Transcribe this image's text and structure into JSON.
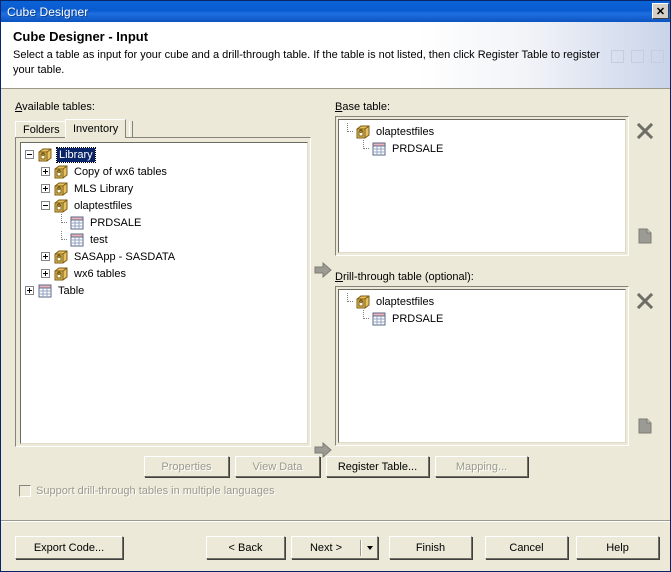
{
  "window": {
    "title": "Cube Designer",
    "close_label": "✕"
  },
  "header": {
    "title": "Cube Designer - Input",
    "description": "Select a table as input for your cube and a drill-through table. If the table is not listed, then click Register Table to register your table."
  },
  "left_panel": {
    "label": "Available tables:",
    "tabs": [
      {
        "label": "Folders",
        "active": false
      },
      {
        "label": "Inventory",
        "active": true
      }
    ],
    "tree": [
      {
        "label": "Library",
        "indent": 0,
        "expander": "minus",
        "icon": "library-icon",
        "selected": true
      },
      {
        "label": "Copy of wx6 tables",
        "indent": 1,
        "expander": "plus",
        "icon": "library-icon",
        "selected": false
      },
      {
        "label": "MLS Library",
        "indent": 1,
        "expander": "plus",
        "icon": "library-icon",
        "selected": false
      },
      {
        "label": "olaptestfiles",
        "indent": 1,
        "expander": "minus",
        "icon": "library-icon",
        "selected": false
      },
      {
        "label": "PRDSALE",
        "indent": 2,
        "expander": "none",
        "icon": "table-icon",
        "selected": false
      },
      {
        "label": "test",
        "indent": 2,
        "expander": "none",
        "icon": "table-icon",
        "selected": false
      },
      {
        "label": "SASApp - SASDATA",
        "indent": 1,
        "expander": "plus",
        "icon": "library-icon",
        "selected": false
      },
      {
        "label": "wx6 tables",
        "indent": 1,
        "expander": "plus",
        "icon": "library-icon",
        "selected": false
      },
      {
        "label": "Table",
        "indent": 0,
        "expander": "plus",
        "icon": "table-icon",
        "selected": false
      }
    ]
  },
  "base_table": {
    "label": "Base table:",
    "items": [
      {
        "label": "olaptestfiles",
        "indent": 0,
        "icon": "library-icon"
      },
      {
        "label": "PRDSALE",
        "indent": 1,
        "icon": "table-icon"
      }
    ]
  },
  "drill_table": {
    "label": "Drill-through table (optional):",
    "items": [
      {
        "label": "olaptestfiles",
        "indent": 0,
        "icon": "library-icon"
      },
      {
        "label": "PRDSALE",
        "indent": 1,
        "icon": "table-icon"
      }
    ]
  },
  "actions": {
    "properties": "Properties",
    "view_data": "View Data",
    "register_table": "Register Table...",
    "mapping": "Mapping..."
  },
  "checkbox": {
    "label": "Support drill-through tables in multiple languages",
    "checked": false,
    "enabled": false
  },
  "footer": {
    "export_code": "Export Code...",
    "back": "< Back",
    "next": "Next >",
    "finish": "Finish",
    "cancel": "Cancel",
    "help": "Help"
  },
  "colors": {
    "titlebar": "#0A5AD0",
    "dialog_bg": "#ECE9D8",
    "selection": "#0A246A",
    "list_bg": "#FFFFFF",
    "disabled_text": "#9A9A8C"
  }
}
